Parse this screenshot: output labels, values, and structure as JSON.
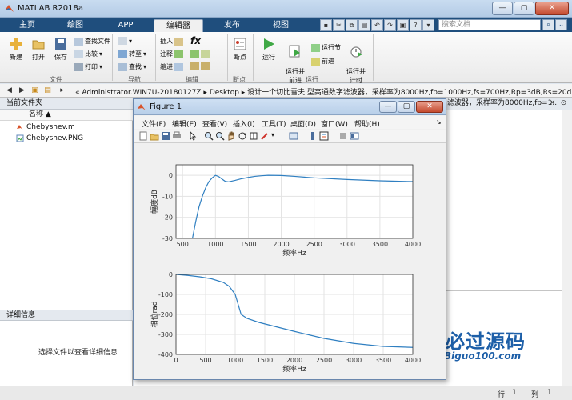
{
  "window": {
    "title": "MATLAB R2018a",
    "controls": {
      "minimize": "—",
      "maximize": "▢",
      "close": "✕"
    }
  },
  "tabs": [
    {
      "label": "主页"
    },
    {
      "label": "绘图"
    },
    {
      "label": "APP"
    },
    {
      "label": "编辑器"
    },
    {
      "label": "发布"
    },
    {
      "label": "视图"
    }
  ],
  "search": {
    "placeholder": "搜索文档"
  },
  "ribbon": {
    "file": {
      "new": "新建",
      "open": "打开",
      "save": "保存",
      "find_files": "查找文件",
      "compare": "比较",
      "print": "打印",
      "group": "文件"
    },
    "navigate": {
      "goto": "转至",
      "find": "查找",
      "group": "导航"
    },
    "edit": {
      "insert": "插入",
      "comment": "注释",
      "indent": "缩进",
      "fx": "fx",
      "group": "编辑"
    },
    "breakpoints": {
      "label": "断点",
      "group": "断点"
    },
    "run": {
      "run": "运行",
      "run_advance": "运行并\n前进",
      "run_section": "运行节",
      "advance": "前进",
      "run_time": "运行并\n计时",
      "group": "运行"
    }
  },
  "address": {
    "path": "« Administrator.WIN7U-20180127Z  ▸  Desktop  ▸  设计一个切比雪夫I型高通数字滤波器，采样率为8000Hz,fp=1000Hz,fs=700Hz,Rp=3dB,Rs=20dB"
  },
  "left_panel": {
    "title": "当前文件夹",
    "column": "名称 ▲",
    "files": [
      {
        "name": "Chebyshev.m",
        "icon": "m-file-icon"
      },
      {
        "name": "Chebyshev.PNG",
        "icon": "image-file-icon"
      }
    ],
    "details_title": "详细信息",
    "details_text": "选择文件以查看详细信息"
  },
  "editor": {
    "tab_text": "滤波器，采样率为8000Hz,fp=1..."
  },
  "status": {
    "row_label": "行",
    "row": "1",
    "col_label": "列",
    "col": "1"
  },
  "figure": {
    "title": "Figure 1",
    "menu": [
      "文件(F)",
      "编辑(E)",
      "查看(V)",
      "插入(I)",
      "工具(T)",
      "桌面(D)",
      "窗口(W)",
      "帮助(H)"
    ]
  },
  "chart_data": [
    {
      "type": "line",
      "title": "",
      "xlabel": "频率Hz",
      "ylabel": "幅度dB",
      "xlim": [
        400,
        4000
      ],
      "ylim": [
        -30,
        5
      ],
      "xticks": [
        500,
        1000,
        1500,
        2000,
        2500,
        3000,
        3500,
        4000
      ],
      "yticks": [
        0,
        -10,
        -20,
        -30
      ],
      "grid": true,
      "series": [
        {
          "x": [
            650,
            700,
            750,
            800,
            850,
            900,
            950,
            1000,
            1050,
            1100,
            1150,
            1200,
            1300,
            1400,
            1500,
            1600,
            1700,
            1800,
            2000,
            2200,
            2500,
            3000,
            3500,
            4000
          ],
          "y": [
            -30,
            -22,
            -15,
            -10,
            -6,
            -3,
            -1.2,
            0,
            -0.6,
            -1.8,
            -2.9,
            -3.1,
            -2.4,
            -1.6,
            -1.0,
            -0.5,
            -0.2,
            0,
            -0.1,
            -0.5,
            -1.2,
            -2.0,
            -2.6,
            -3.0
          ]
        }
      ]
    },
    {
      "type": "line",
      "title": "",
      "xlabel": "频率Hz",
      "ylabel": "相位rad",
      "xlim": [
        0,
        4000
      ],
      "ylim": [
        -400,
        0
      ],
      "xticks": [
        0,
        500,
        1000,
        1500,
        2000,
        2500,
        3000,
        3500,
        4000
      ],
      "yticks": [
        0,
        -100,
        -200,
        -300,
        -400
      ],
      "grid": true,
      "series": [
        {
          "x": [
            0,
            200,
            400,
            600,
            800,
            900,
            1000,
            1050,
            1100,
            1200,
            1400,
            1600,
            2000,
            2500,
            3000,
            3500,
            4000
          ],
          "y": [
            0,
            -5,
            -12,
            -22,
            -40,
            -60,
            -100,
            -150,
            -200,
            -220,
            -240,
            -255,
            -285,
            -320,
            -345,
            -360,
            -365
          ]
        }
      ]
    }
  ],
  "watermark": {
    "title": "必过源码",
    "sub": "Biguo100.com"
  },
  "colors": {
    "accent": "#1f4e7d",
    "plot_line": "#2f7fc1",
    "watermark": "#1d5fa8"
  }
}
